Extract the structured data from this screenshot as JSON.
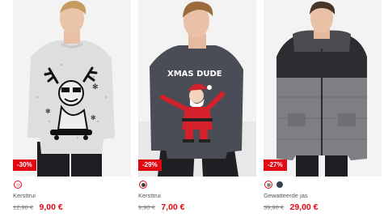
{
  "products": [
    {
      "badge": "-30%",
      "swatches": [
        {
          "color": "#e7c9c9",
          "selected": true
        }
      ],
      "name": "Kersttrui",
      "old_price": "12,90 €",
      "new_price": "9,00 €"
    },
    {
      "badge": "-29%",
      "swatches": [
        {
          "color": "#3d3d45",
          "selected": true
        }
      ],
      "name": "Kersttrui",
      "old_price": "9,90 €",
      "new_price": "7,00 €"
    },
    {
      "badge": "-27%",
      "swatches": [
        {
          "color": "#8a8a8a",
          "selected": true
        },
        {
          "color": "#3a4150",
          "selected": false
        }
      ],
      "name": "Gewatteerde jas",
      "old_price": "39,90 €",
      "new_price": "29,00 €"
    }
  ],
  "colors": {
    "accent": "#e30613"
  }
}
